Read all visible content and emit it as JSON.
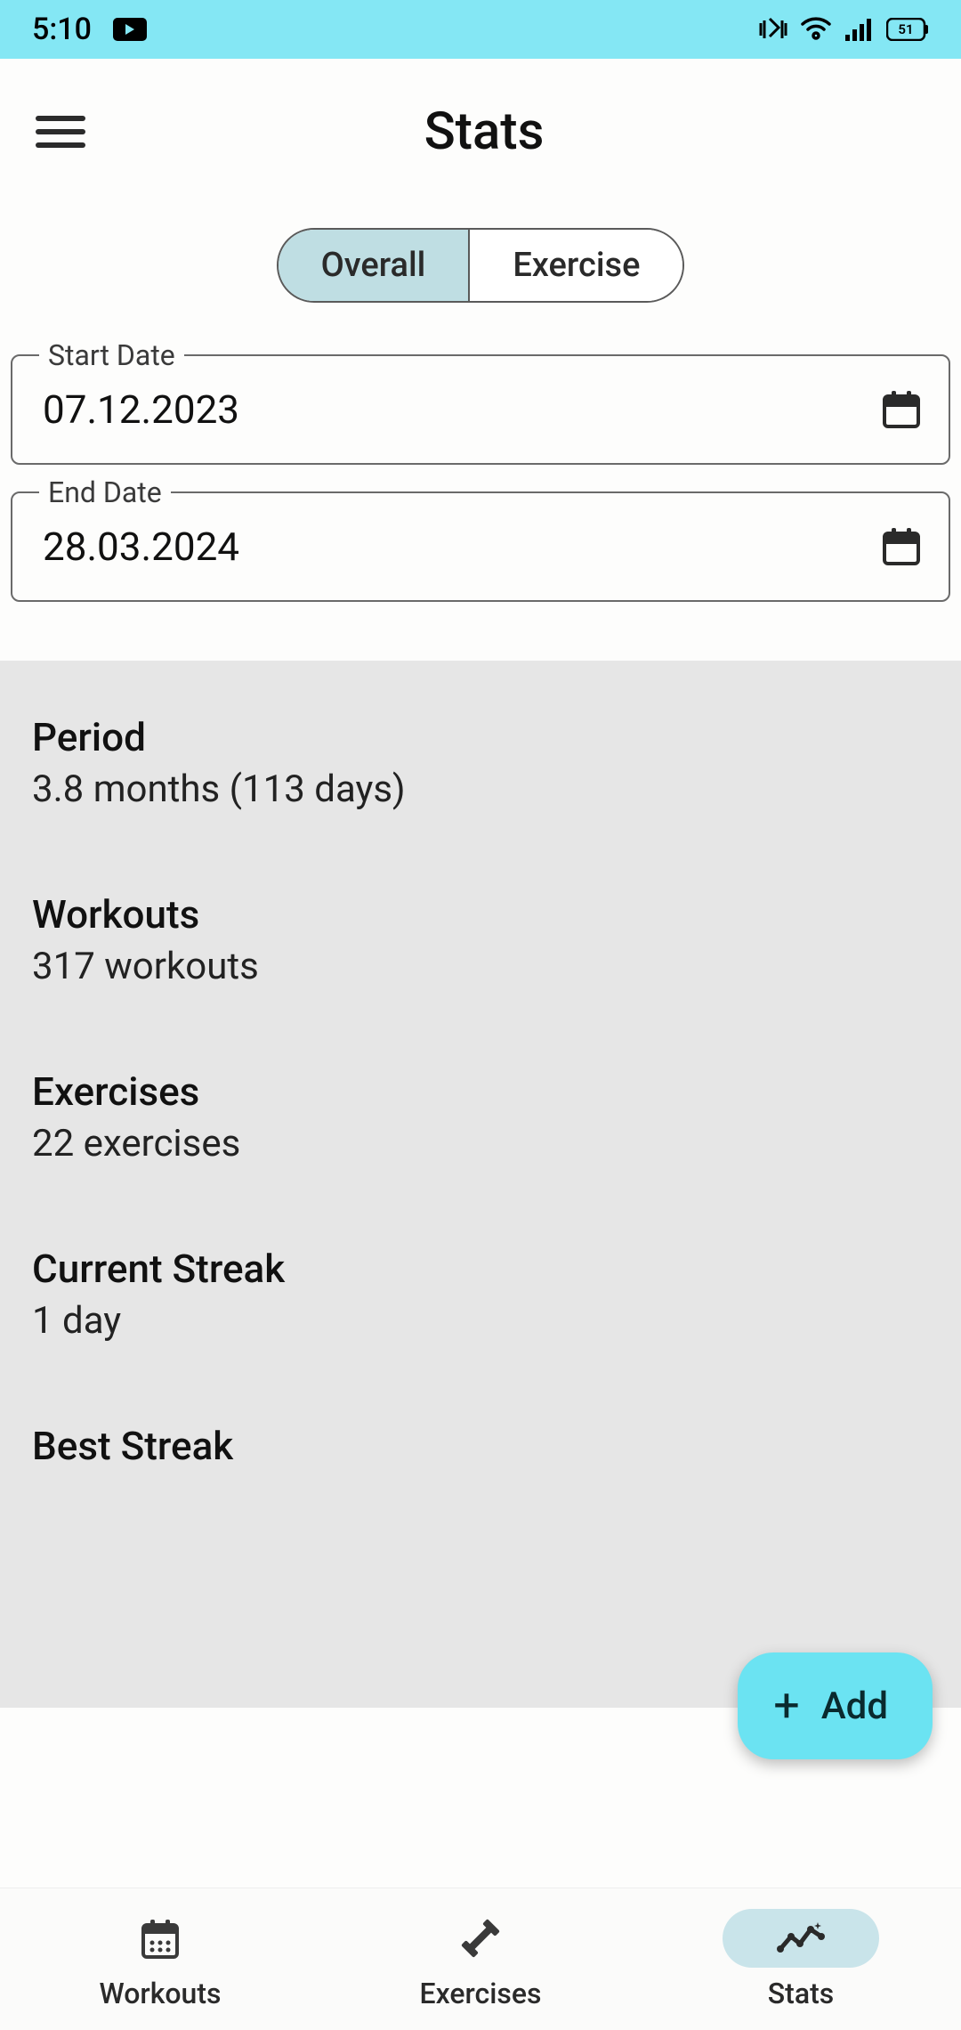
{
  "status": {
    "time": "5:10",
    "battery": "51"
  },
  "header": {
    "title": "Stats"
  },
  "tabs": {
    "overall": "Overall",
    "exercise": "Exercise"
  },
  "fields": {
    "start": {
      "label": "Start Date",
      "value": "07.12.2023"
    },
    "end": {
      "label": "End Date",
      "value": "28.03.2024"
    }
  },
  "stats": [
    {
      "title": "Period",
      "value": "3.8 months (113 days)"
    },
    {
      "title": "Workouts",
      "value": "317 workouts"
    },
    {
      "title": "Exercises",
      "value": "22 exercises"
    },
    {
      "title": "Current Streak",
      "value": "1 day"
    },
    {
      "title": "Best Streak",
      "value": ""
    }
  ],
  "fab": {
    "label": "Add"
  },
  "nav": {
    "workouts": "Workouts",
    "exercises": "Exercises",
    "stats": "Stats"
  }
}
